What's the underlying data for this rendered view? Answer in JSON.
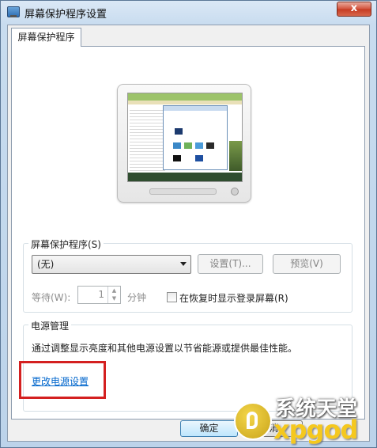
{
  "window": {
    "title": "屏幕保护程序设置",
    "close_glyph": "x"
  },
  "tabs": [
    {
      "label": "屏幕保护程序",
      "active": true
    }
  ],
  "screensaver": {
    "group_label": "屏幕保护程序(S)",
    "selected": "(无)",
    "settings_button": "设置(T)...",
    "preview_button": "预览(V)",
    "wait_label": "等待(W):",
    "wait_value": "1",
    "wait_unit": "分钟",
    "resume_checkbox_label": "在恢复时显示登录屏幕(R)",
    "resume_checked": false
  },
  "power": {
    "group_label": "电源管理",
    "description": "通过调整显示亮度和其他电源设置以节省能源或提供最佳性能。",
    "link": "更改电源设置"
  },
  "footer": {
    "ok_button": "确定",
    "cancel_button": "消"
  },
  "watermark": {
    "cn": "系统天堂",
    "en": "xpgod"
  },
  "colors": {
    "link": "#0066cc",
    "highlight": "#d42020",
    "close_button": "#c53a22"
  }
}
